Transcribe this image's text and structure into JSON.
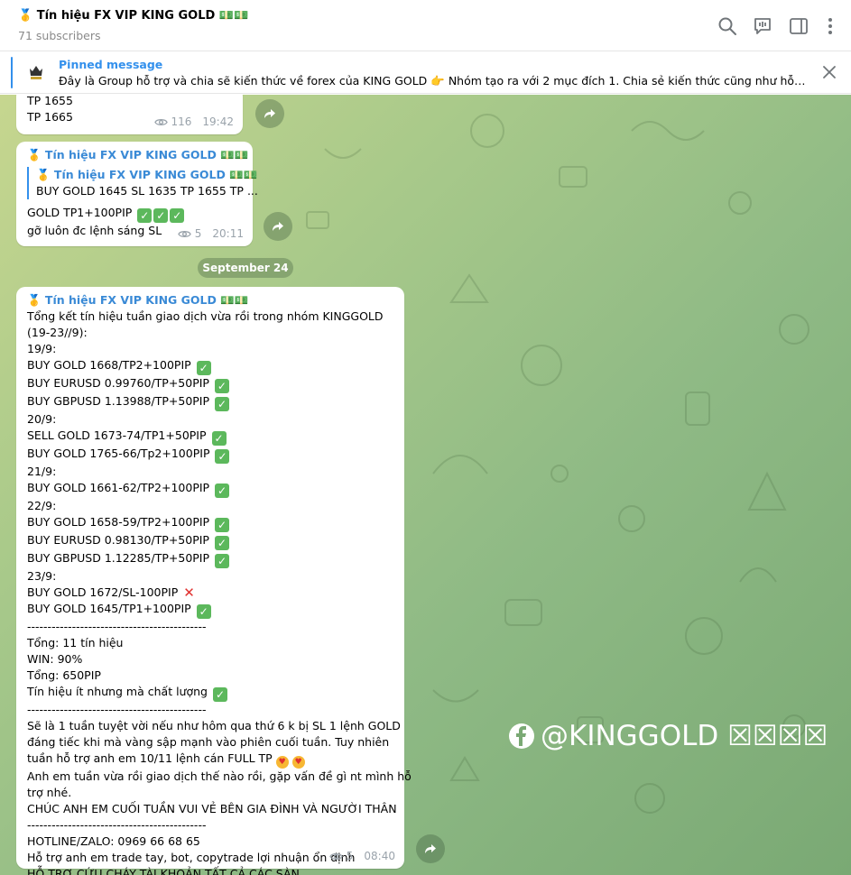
{
  "header": {
    "title": "🥇 Tín hiệu FX VIP KING GOLD 💵💵",
    "subscribers": "71 subscribers"
  },
  "pinned": {
    "title": "Pinned message",
    "text": "Đây là Group hỗ trợ và chia sẽ kiến thức về forex của KING GOLD  👉 Nhóm tạo ra với 2 mục đích  1. Chia sẻ kiến thức cũng như hỗ trợ p..."
  },
  "messages": {
    "m1": {
      "lines": [
        "TP 1655",
        "TP 1665"
      ],
      "views": "116",
      "time": "19:42"
    },
    "m2": {
      "sender": "🥇 Tín hiệu FX VIP KING GOLD 💵💵",
      "reply_name": "🥇 Tín hiệu FX VIP KING GOLD 💵💵",
      "reply_text": "BUY GOLD 1645 SL 1635 TP 1655 TP ...",
      "line1": "GOLD TP1+100PIP",
      "line2": "gỡ luôn đc lệnh sáng SL",
      "views": "5",
      "time": "20:11"
    },
    "date": "September 24",
    "m3": {
      "sender": "🥇 Tín hiệu FX VIP KING GOLD 💵💵",
      "l01": "Tổng kết tín hiệu tuần giao dịch vừa rồi trong nhóm KINGGOLD",
      "l02": "(19-23//9):",
      "l03": "19/9:",
      "l04": "BUY GOLD  1668/TP2+100PIP",
      "l05": "BUY EURUSD  0.99760/TP+50PIP",
      "l06": "BUY GBPUSD  1.13988/TP+50PIP",
      "l07": "20/9:",
      "l08": "SELL GOLD 1673-74/TP1+50PIP",
      "l09": "BUY  GOLD  1765-66/Tp2+100PIP",
      "l10": "21/9:",
      "l11": "BUY GOLD 1661-62/TP2+100PIP",
      "l12": "22/9:",
      "l13": "BUY GOLD 1658-59/TP2+100PIP",
      "l14": "BUY EURUSD  0.98130/TP+50PIP",
      "l15": "BUY GBPUSD  1.12285/TP+50PIP",
      "l16": "23/9:",
      "l17": "BUY GOLD 1672/SL-100PIP",
      "l18": "BUY GOLD 1645/TP1+100PIP",
      "l19": "--------------------------------------------",
      "l20": "Tổng: 11 tín hiệu",
      "l21": "WIN: 90%",
      "l22": "Tổng: 650PIP",
      "l23": "Tín hiệu ít nhưng mà chất lượng",
      "l24": "--------------------------------------------",
      "l25": "Sẽ là 1 tuần tuyệt vời nếu như hôm qua thứ 6 k bị SL 1 lệnh GOLD",
      "l26": "đáng tiếc khi mà vàng sập mạnh vào phiên cuối tuần. Tuy nhiên",
      "l27": "tuần hỗ trợ anh em 10/11 lệnh cán FULL TP",
      "l28": "Anh em tuần vừa rồi giao dịch thế nào rồi, gặp vấn đề gì nt mình hỗ",
      "l29": "trợ nhé.",
      "l30": "CHÚC ANH EM CUỐI TUẦN VUI VẺ BÊN GIA ĐÌNH VÀ NGƯỜI THÂN",
      "l31": "--------------------------------------------",
      "l32": "HOTLINE/ZALO: 0969 66 68 65",
      "l33": "Hỗ trợ anh em trade tay, bot, copytrade lợi nhuận ổn định",
      "l34": "HỖ TRỢ CỨU CHÁY TÀI KHOẢN TẤT CẢ CÁC SÀN.",
      "views": "5",
      "time": "08:40"
    }
  },
  "watermark": "@KINGGOLD ☒☒☒☒",
  "icons": {
    "search": "search-icon",
    "comments": "comments-icon",
    "sidebar": "sidebar-toggle-icon",
    "more": "more-icon",
    "close": "close-icon",
    "share": "share-icon",
    "views": "eye-icon"
  },
  "colors": {
    "accent": "#3390ec",
    "sender": "#3a8ad6",
    "check": "#5cb85c",
    "cross": "#e0312f"
  }
}
